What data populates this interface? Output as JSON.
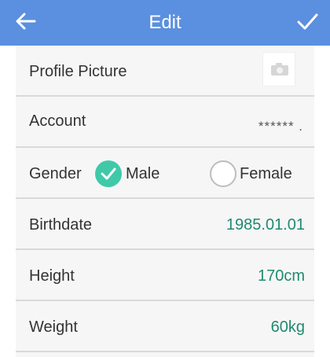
{
  "header": {
    "title": "Edit",
    "back_icon": "back-arrow-icon",
    "done_icon": "checkmark-icon",
    "bg_color": "#5b8fe0"
  },
  "rows": {
    "profile_picture": {
      "label": "Profile Picture",
      "icon": "camera-icon"
    },
    "account": {
      "label": "Account",
      "value": "****** ."
    },
    "gender": {
      "label": "Gender",
      "options": [
        "Male",
        "Female"
      ],
      "selected": "Male"
    },
    "birthdate": {
      "label": "Birthdate",
      "value": "1985.01.01"
    },
    "height": {
      "label": "Height",
      "value": "170cm"
    },
    "weight": {
      "label": "Weight",
      "value": "60kg"
    }
  },
  "colors": {
    "accent": "#3fc9a8",
    "value_text": "#1f8a6e",
    "divider": "#d9d9d9"
  }
}
